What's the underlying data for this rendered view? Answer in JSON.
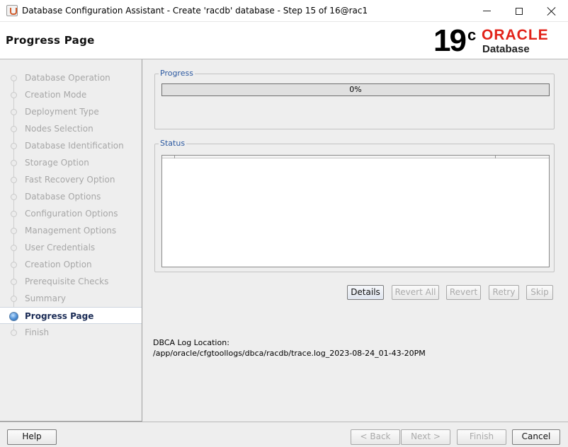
{
  "window": {
    "title": "Database Configuration Assistant - Create 'racdb' database - Step 15 of 16@rac1",
    "app_icon": "java-cup-icon"
  },
  "header": {
    "page_title": "Progress Page",
    "logo": {
      "version": "19",
      "version_sup": "c",
      "brand": "ORACLE",
      "product": "Database",
      "brand_color": "#e2231a"
    }
  },
  "sidebar": {
    "steps": [
      {
        "label": "Database Operation",
        "state": "done"
      },
      {
        "label": "Creation Mode",
        "state": "done"
      },
      {
        "label": "Deployment Type",
        "state": "done"
      },
      {
        "label": "Nodes Selection",
        "state": "done"
      },
      {
        "label": "Database Identification",
        "state": "done"
      },
      {
        "label": "Storage Option",
        "state": "done"
      },
      {
        "label": "Fast Recovery Option",
        "state": "done"
      },
      {
        "label": "Database Options",
        "state": "done"
      },
      {
        "label": "Configuration Options",
        "state": "done"
      },
      {
        "label": "Management Options",
        "state": "done"
      },
      {
        "label": "User Credentials",
        "state": "done"
      },
      {
        "label": "Creation Option",
        "state": "done"
      },
      {
        "label": "Prerequisite Checks",
        "state": "done"
      },
      {
        "label": "Summary",
        "state": "done"
      },
      {
        "label": "Progress Page",
        "state": "current"
      },
      {
        "label": "Finish",
        "state": "pending"
      }
    ]
  },
  "progress": {
    "group_title": "Progress",
    "percent_text": "0%",
    "fraction": 0
  },
  "status": {
    "group_title": "Status"
  },
  "actions": {
    "details": "Details",
    "revert_all": "Revert All",
    "revert": "Revert",
    "retry": "Retry",
    "skip": "Skip"
  },
  "log": {
    "label": "DBCA Log Location:",
    "path": "/app/oracle/cfgtoollogs/dbca/racdb/trace.log_2023-08-24_01-43-20PM"
  },
  "footer": {
    "help": "Help",
    "back": "< Back",
    "next": "Next >",
    "finish": "Finish",
    "cancel": "Cancel"
  }
}
